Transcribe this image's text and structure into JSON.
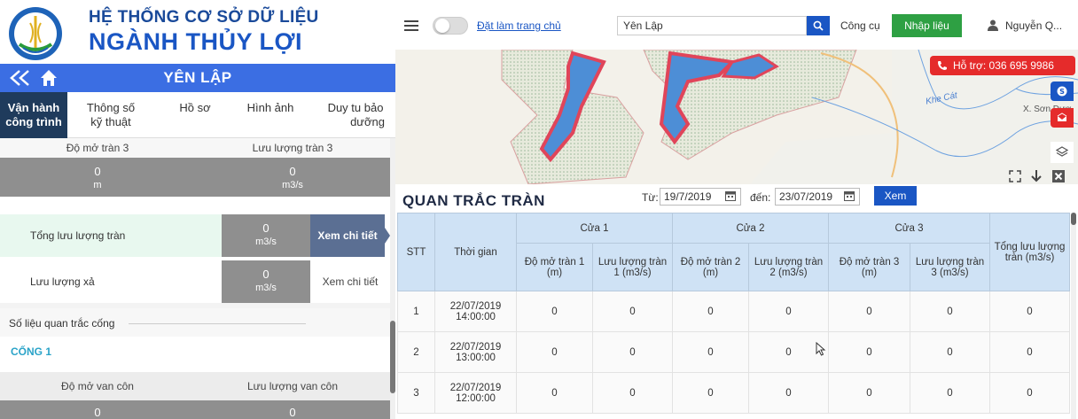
{
  "brand": {
    "line1": "HỆ THỐNG CƠ SỞ DỮ LIỆU",
    "line2": "NGÀNH THỦY LỢI"
  },
  "station": "YÊN LẬP",
  "tabs": [
    {
      "label1": "Vận hành",
      "label2": "công trình"
    },
    {
      "label1": "Thông số",
      "label2": "kỹ thuật"
    },
    {
      "label1": "Hồ sơ",
      "label2": ""
    },
    {
      "label1": "Hình ảnh",
      "label2": ""
    },
    {
      "label1": "Duy tu bảo",
      "label2": "dưỡng"
    }
  ],
  "spill3": {
    "open_label": "Độ mở tràn 3",
    "flow_label": "Lưu lượng tràn 3",
    "open_value": "0",
    "open_unit": "m",
    "flow_value": "0",
    "flow_unit": "m3/s"
  },
  "total_spill": {
    "label": "Tổng lưu lượng tràn",
    "value": "0",
    "unit": "m3/s",
    "link": "Xem chi tiết"
  },
  "discharge": {
    "label": "Lưu lượng xả",
    "value": "0",
    "unit": "m3/s",
    "link": "Xem chi tiết"
  },
  "culvert_section": "Số liệu quan trắc cống",
  "culvert1": {
    "title": "CỐNG 1",
    "open_label": "Độ mở van côn",
    "flow_label": "Lưu lượng van côn",
    "open_value": "0",
    "flow_value": "0"
  },
  "topbar": {
    "set_home": "Đặt làm trang chủ",
    "search_value": "Yên Lập",
    "tools": "Công cụ",
    "enter_data": "Nhập liệu",
    "user": "Nguyễn Q..."
  },
  "map": {
    "support": "Hỗ trợ: 036 695 9986",
    "label_kh": "Khe Cát",
    "label_xs": "X. Sơn Dươ"
  },
  "panel": {
    "title": "QUAN TRẮC TRÀN",
    "from_label": "Từ:",
    "from_value": "19/7/2019",
    "to_label": "đến:",
    "to_value": "23/07/2019",
    "view": "Xem"
  },
  "table": {
    "stt": "STT",
    "time": "Thời gian",
    "gate1": "Cửa 1",
    "gate2": "Cửa 2",
    "gate3": "Cửa 3",
    "total": "Tổng lưu lượng tràn (m3/s)",
    "sub": [
      "Độ mở tràn 1 (m)",
      "Lưu lượng tràn 1 (m3/s)",
      "Độ mở tràn 2 (m)",
      "Lưu lượng tràn 2 (m3/s)",
      "Độ mở tràn 3 (m)",
      "Lưu lượng tràn 3 (m3/s)"
    ],
    "rows": [
      {
        "stt": "1",
        "date": "22/07/2019",
        "time": "14:00:00",
        "v": [
          "0",
          "0",
          "0",
          "0",
          "0",
          "0",
          "0"
        ]
      },
      {
        "stt": "2",
        "date": "22/07/2019",
        "time": "13:00:00",
        "v": [
          "0",
          "0",
          "0",
          "0",
          "0",
          "0",
          "0"
        ]
      },
      {
        "stt": "3",
        "date": "22/07/2019",
        "time": "12:00:00",
        "v": [
          "0",
          "0",
          "0",
          "0",
          "0",
          "0",
          "0"
        ]
      }
    ]
  },
  "colors": {
    "brand_blue": "#3b6ee3",
    "tab_active": "#1f3b5c",
    "green": "#2ea043",
    "red": "#e52b2b",
    "header_blue": "#cfe2f5"
  }
}
